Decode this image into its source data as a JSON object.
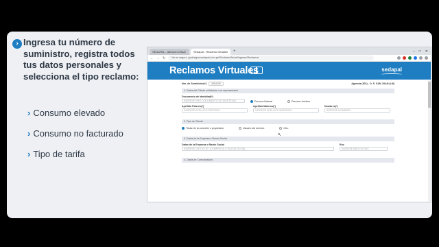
{
  "slide": {
    "intro": "Ingresa tu número de suministro, registra todos tus datos personales y selecciona el tipo reclamo:",
    "bullets": [
      "Consumo elevado",
      "Consumo no facturado",
      "Tipo de tarifa"
    ]
  },
  "browser": {
    "tabs": [
      "SEDAPAL - atención virtual",
      "Sedapal - Reclamo virtuales"
    ],
    "url": "No es seguro | pubsigca.sedapal.com.pe/ReclamoVirtual/Ingreso/Reclamos"
  },
  "site": {
    "title": "Reclamos Virtuales",
    "logo": "sedapal"
  },
  "form": {
    "suministro_label": "Nro. de Suministro(*)",
    "suministro_value": "4564406",
    "agencia": "Agencia (301) - O. S. SAN JUAN (LM)",
    "sec1": "1. Datos del Cliente solicitante o su representante",
    "doc_label": "Documento de Identidad(*)",
    "doc_placeholder": "INGRESE NRO DOCUMENTO DE IDENTIDAD",
    "persona_natural": "Persona Natural",
    "persona_juridica": "Persona Jurídica",
    "ap_paterno_label": "Apellido Paterno(*)",
    "ap_paterno_ph": "INGRESE APELLIDO PATERNO",
    "ap_materno_label": "Apellido Materno(*)",
    "ap_materno_ph": "INGRESE APELLIDO MATERNO",
    "nombres_label": "Nombres(*)",
    "nombres_ph": "INGRESE NOMBRES",
    "sec2": "2. Tipo de Cliente",
    "opt_titular": "Titular de la conexión o propietario",
    "opt_usuario": "Usuario del servicio",
    "opt_otro": "Otro",
    "sec3": "3. Datos de la Empresa o Razón Social",
    "razon_label": "Datos de la Empresa o Razón Social",
    "razon_ph": "INGRESE DATOS DE LA EMPRESA O RAZON SOCIAL",
    "ruc_label": "Ruc",
    "ruc_ph": "INGRESE NRO DE RUC",
    "sec4": "4. Datos de Comunicación"
  }
}
